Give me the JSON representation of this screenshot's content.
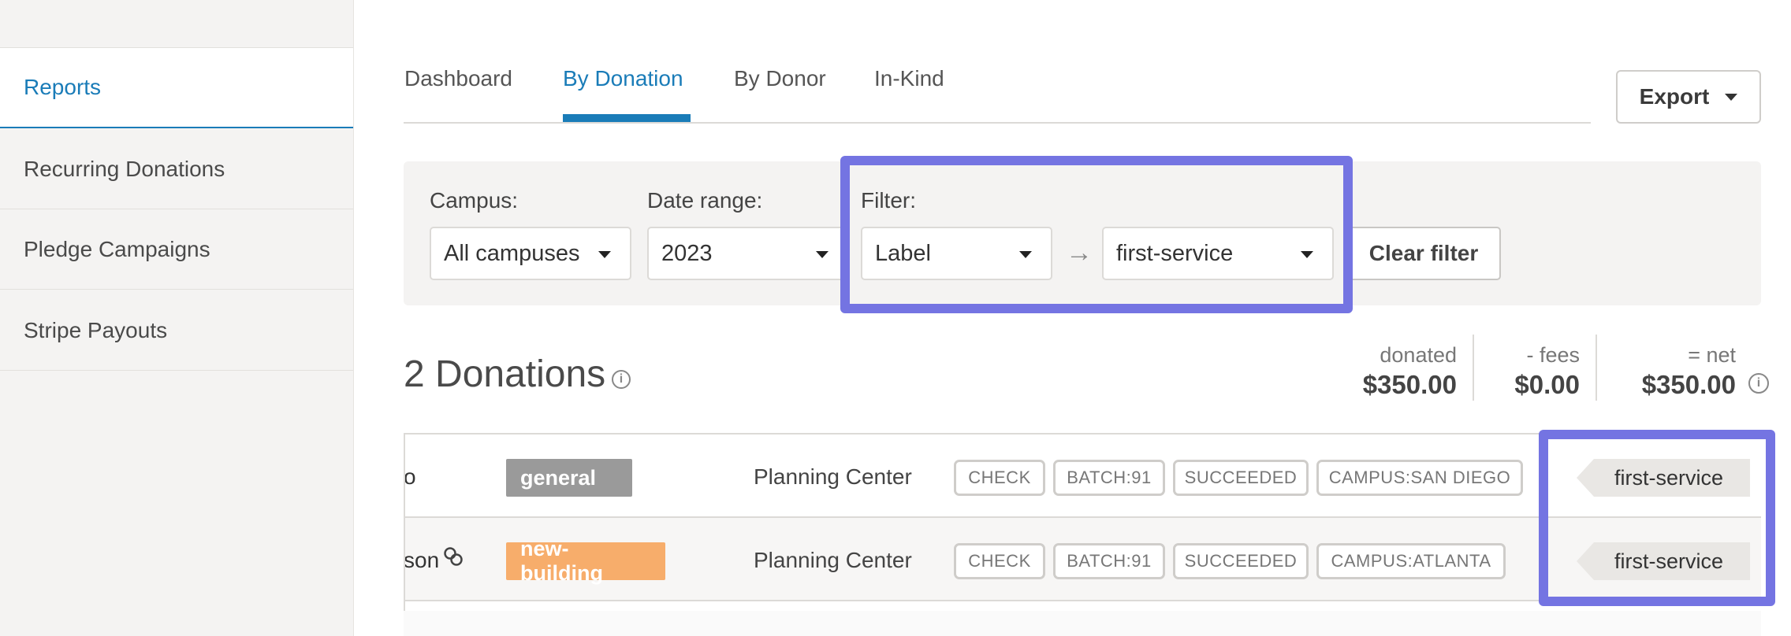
{
  "sidebar": {
    "items": [
      {
        "label": "Reports",
        "active": true
      },
      {
        "label": "Recurring Donations",
        "active": false
      },
      {
        "label": "Pledge Campaigns",
        "active": false
      },
      {
        "label": "Stripe Payouts",
        "active": false
      }
    ]
  },
  "tabs": [
    {
      "label": "Dashboard",
      "active": false
    },
    {
      "label": "By Donation",
      "active": true
    },
    {
      "label": "By Donor",
      "active": false
    },
    {
      "label": "In-Kind",
      "active": false
    }
  ],
  "export": {
    "label": "Export"
  },
  "filters": {
    "campus": {
      "label": "Campus:",
      "value": "All campuses"
    },
    "date_range": {
      "label": "Date range:",
      "value": "2023"
    },
    "filter": {
      "label": "Filter:",
      "field": "Label",
      "value": "first-service"
    },
    "clear_label": "Clear filter"
  },
  "summary": {
    "count_title": "2 Donations",
    "donated_label": "donated",
    "donated_value": "$350.00",
    "fees_label": "- fees",
    "fees_value": "$0.00",
    "net_label": "= net",
    "net_value": "$350.00"
  },
  "rows": [
    {
      "name_fragment": "o",
      "fund": "general",
      "fund_color": "#9a9a9a",
      "source": "Planning Center",
      "chips": [
        "CHECK",
        "BATCH:91",
        "SUCCEEDED",
        "CAMPUS:SAN DIEGO"
      ],
      "label": "first-service"
    },
    {
      "name_fragment": "son",
      "fund": "new-building",
      "fund_color": "#f7ad6b",
      "source": "Planning Center",
      "chips": [
        "CHECK",
        "BATCH:91",
        "SUCCEEDED",
        "CAMPUS:ATLANTA"
      ],
      "label": "first-service"
    }
  ],
  "colors": {
    "accent": "#1a7cb8",
    "highlight": "#7474e2",
    "label_tag": "#e9e7e4"
  }
}
